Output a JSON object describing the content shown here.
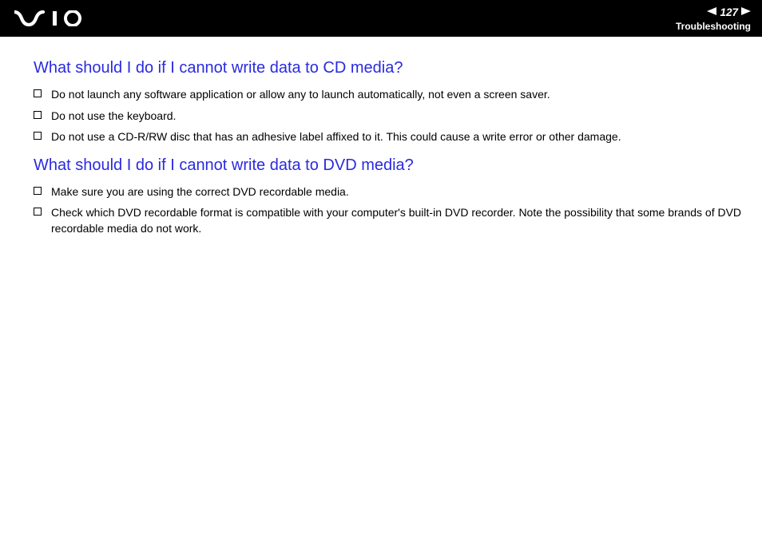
{
  "header": {
    "page_number": "127",
    "section": "Troubleshooting"
  },
  "sections": [
    {
      "heading": "What should I do if I cannot write data to CD media?",
      "items": [
        "Do not launch any software application or allow any to launch automatically, not even a screen saver.",
        "Do not use the keyboard.",
        "Do not use a CD-R/RW disc that has an adhesive label affixed to it. This could cause a write error or other damage."
      ]
    },
    {
      "heading": "What should I do if I cannot write data to DVD media?",
      "items": [
        "Make sure you are using the correct DVD recordable media.",
        "Check which DVD recordable format is compatible with your computer's built-in DVD recorder. Note the possibility that some brands of DVD recordable media do not work."
      ]
    }
  ]
}
